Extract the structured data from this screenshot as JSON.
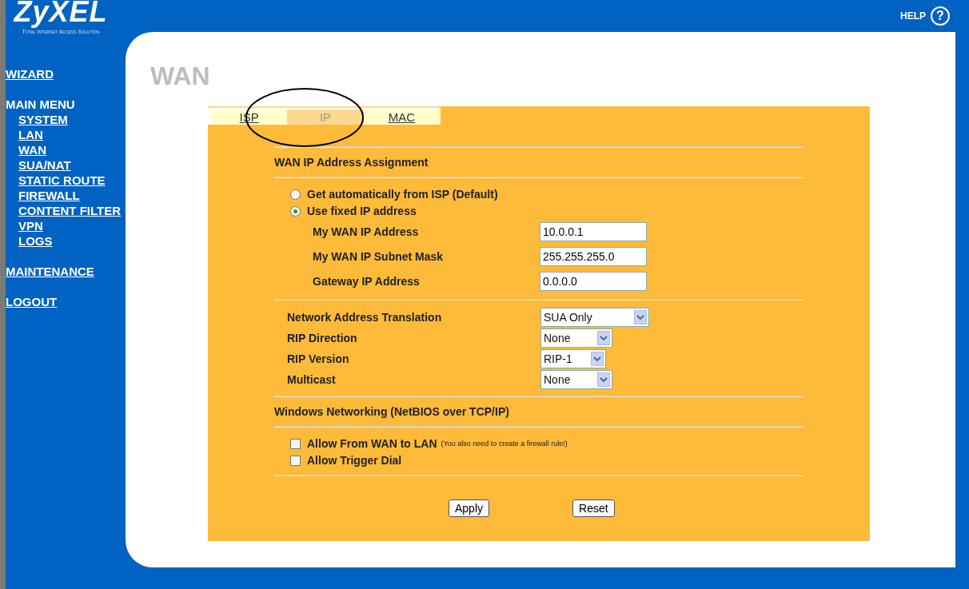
{
  "logo": {
    "name": "ZyXEL",
    "tagline": "Total Internet Access Solution"
  },
  "help": {
    "label": "HELP",
    "icon": "?"
  },
  "sidebar": {
    "items": [
      {
        "label": "WIZARD",
        "kind": "link"
      },
      {
        "label": "MAIN MENU",
        "kind": "heading",
        "children": [
          {
            "label": "SYSTEM",
            "kind": "link"
          },
          {
            "label": "LAN",
            "kind": "link"
          },
          {
            "label": "WAN",
            "kind": "link"
          },
          {
            "label": "SUA/NAT",
            "kind": "link"
          },
          {
            "label": "STATIC ROUTE",
            "kind": "link"
          },
          {
            "label": "FIREWALL",
            "kind": "link"
          },
          {
            "label": "CONTENT FILTER",
            "kind": "link"
          },
          {
            "label": "VPN",
            "kind": "link"
          },
          {
            "label": "LOGS",
            "kind": "link"
          }
        ]
      },
      {
        "label": "MAINTENANCE",
        "kind": "link"
      },
      {
        "label": "LOGOUT",
        "kind": "link"
      }
    ]
  },
  "page_title": "WAN",
  "tabs": [
    {
      "label": "ISP",
      "selected": false
    },
    {
      "label": "IP",
      "selected": true
    },
    {
      "label": "MAC",
      "selected": false
    }
  ],
  "assignment": {
    "heading": "WAN IP Address Assignment",
    "options": [
      {
        "label": "Get automatically from ISP (Default)",
        "selected": false
      },
      {
        "label": "Use fixed IP address",
        "selected": true
      }
    ],
    "fields": [
      {
        "label": "My WAN IP Address",
        "value": "10.0.0.1"
      },
      {
        "label": "My WAN IP Subnet Mask",
        "value": "255.255.255.0"
      },
      {
        "label": "Gateway IP Address",
        "value": "0.0.0.0"
      }
    ]
  },
  "selects": [
    {
      "label": "Network Address Translation",
      "value": "SUA Only"
    },
    {
      "label": "RIP Direction",
      "value": "None"
    },
    {
      "label": "RIP Version",
      "value": "RIP-1"
    },
    {
      "label": "Multicast",
      "value": "None"
    }
  ],
  "netbios": {
    "heading": "Windows Networking (NetBIOS over TCP/IP)",
    "options": [
      {
        "label": "Allow From WAN to LAN",
        "note": "(You also need to create a firewall rule!)",
        "checked": false
      },
      {
        "label": "Allow Trigger Dial",
        "checked": false
      }
    ]
  },
  "buttons": [
    "Apply",
    "Reset"
  ]
}
